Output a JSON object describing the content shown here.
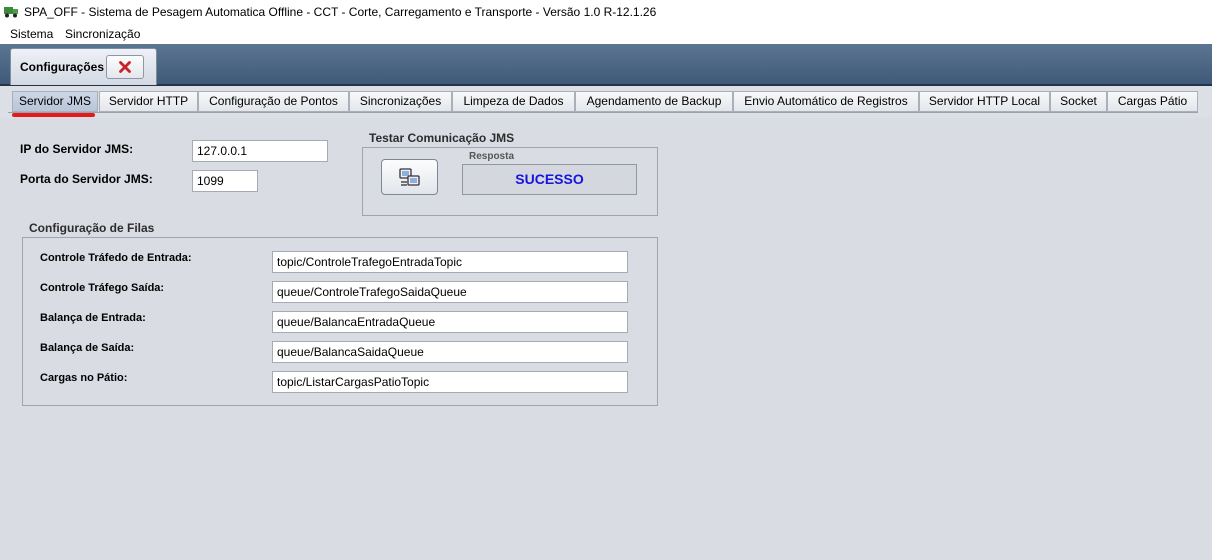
{
  "window": {
    "title": "SPA_OFF - Sistema de Pesagem Automatica Offline - CCT - Corte, Carregamento e Transporte - Versão 1.0 R-12.1.26",
    "icon": "truck-icon"
  },
  "menu": {
    "items": [
      "Sistema",
      "Sincronização"
    ]
  },
  "main_tab": {
    "label": "Configurações",
    "close_icon": "close-x-icon"
  },
  "subtabs": {
    "items": [
      "Servidor JMS",
      "Servidor HTTP",
      "Configuração de Pontos",
      "Sincronizações",
      "Limpeza de Dados",
      "Agendamento de Backup",
      "Envio Automático de Registros",
      "Servidor HTTP Local",
      "Socket",
      "Cargas Pátio"
    ],
    "active": "Servidor JMS"
  },
  "jms": {
    "ip_label": "IP do Servidor JMS:",
    "ip_value": "127.0.0.1",
    "port_label": "Porta do Servidor JMS:",
    "port_value": "1099"
  },
  "test": {
    "group_title": "Testar Comunicação JMS",
    "button_icon": "network-test-icon",
    "response_label": "Resposta",
    "response_value": "SUCESSO",
    "response_color": "#1515e0"
  },
  "queues": {
    "group_title": "Configuração de Filas",
    "rows": [
      {
        "label": "Controle Tráfedo de Entrada:",
        "value": "topic/ControleTrafegoEntradaTopic"
      },
      {
        "label": "Controle Tráfego Saída:",
        "value": "queue/ControleTrafegoSaidaQueue"
      },
      {
        "label": "Balança de Entrada:",
        "value": "queue/BalancaEntradaQueue"
      },
      {
        "label": "Balança de Saída:",
        "value": "queue/BalancaSaidaQueue"
      },
      {
        "label": "Cargas no Pátio:",
        "value": "topic/ListarCargasPatioTopic"
      }
    ]
  },
  "colors": {
    "header_band": "#3f5a78",
    "background": "#d9dce3",
    "highlight": "#e41b1b"
  }
}
